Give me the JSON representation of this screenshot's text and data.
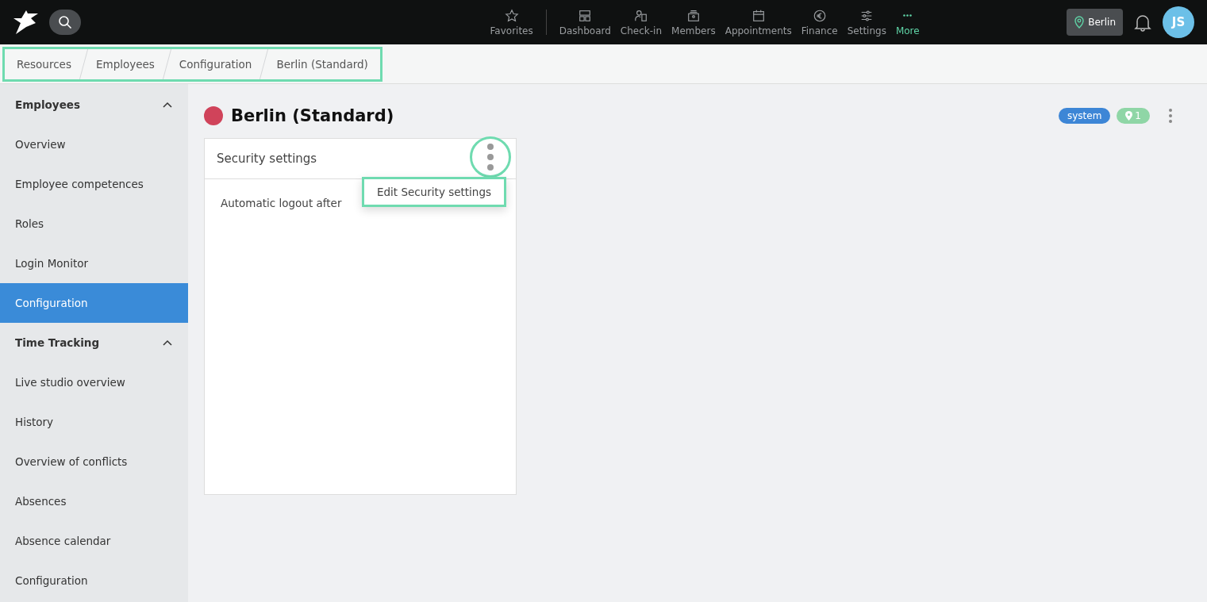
{
  "topbar": {
    "nav": [
      {
        "label": "Favorites",
        "selected": false
      },
      {
        "label": "Dashboard",
        "selected": false
      },
      {
        "label": "Check-in",
        "selected": false
      },
      {
        "label": "Members",
        "selected": false
      },
      {
        "label": "Appointments",
        "selected": false
      },
      {
        "label": "Finance",
        "selected": false
      },
      {
        "label": "Settings",
        "selected": false
      },
      {
        "label": "More",
        "selected": true
      }
    ],
    "location": "Berlin",
    "avatar": "JS"
  },
  "breadcrumb": {
    "highlighted": true,
    "items": [
      "Resources",
      "Employees",
      "Configuration",
      "Berlin (Standard)"
    ]
  },
  "sidebar": {
    "sections": [
      {
        "title": "Employees",
        "expanded": true,
        "items": [
          {
            "label": "Overview",
            "selected": false
          },
          {
            "label": "Employee competences",
            "selected": false
          },
          {
            "label": "Roles",
            "selected": false
          },
          {
            "label": "Login Monitor",
            "selected": false
          },
          {
            "label": "Configuration",
            "selected": true
          }
        ]
      },
      {
        "title": "Time Tracking",
        "expanded": true,
        "items": [
          {
            "label": "Live studio overview",
            "selected": false
          },
          {
            "label": "History",
            "selected": false
          },
          {
            "label": "Overview of conflicts",
            "selected": false
          },
          {
            "label": "Absences",
            "selected": false
          },
          {
            "label": "Absence calendar",
            "selected": false
          },
          {
            "label": "Configuration",
            "selected": false
          }
        ]
      }
    ]
  },
  "page": {
    "title": "Berlin (Standard)",
    "color": "#d0435a",
    "tags": [
      {
        "kind": "text",
        "label": "system",
        "color": "#3d86d6"
      },
      {
        "kind": "location",
        "label": "1",
        "color": "#8fd6a6"
      }
    ]
  },
  "card": {
    "title": "Security settings",
    "menu_highlighted": true,
    "rows": [
      {
        "label": "Automatic logout after"
      }
    ],
    "menu": {
      "open": true,
      "items": [
        {
          "label": "Edit Security settings",
          "highlighted": true
        }
      ]
    }
  }
}
